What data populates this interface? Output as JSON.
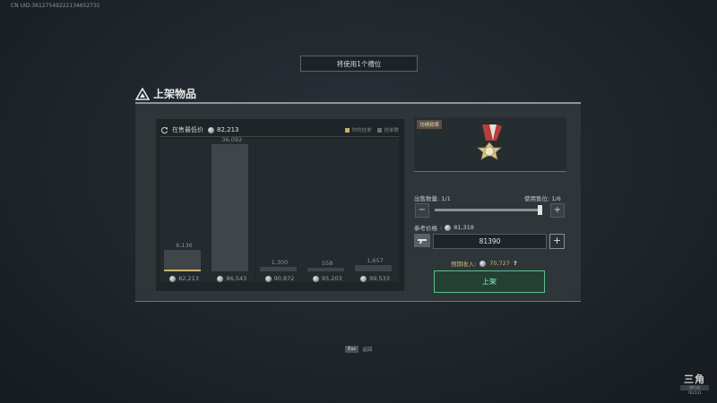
{
  "uid": "CN UID:36127549222134652731",
  "slot_notice": "将使用1个槽位",
  "title": "上架物品",
  "chart": {
    "lowest_label": "在售最低价",
    "lowest_price": "82,213",
    "legend_mine": "你的挂单",
    "legend_orders": "挂单数",
    "accent_color": "#c8b46a"
  },
  "chart_data": {
    "type": "bar",
    "categories": [
      "82,213",
      "86,543",
      "90,872",
      "95,203",
      "99,533"
    ],
    "series": [
      {
        "values": [
          6136,
          36092,
          1300,
          558,
          1657
        ]
      }
    ],
    "value_labels": [
      "6,136",
      "36,092",
      "1,300",
      "558",
      "1,657"
    ],
    "ylim": [
      0,
      37500
    ]
  },
  "item": {
    "name_tag": "功绩勋章",
    "icon": "medal-icon"
  },
  "quantity": {
    "label": "出售数量",
    "value": "1/1",
    "slot_label": "使用售位",
    "slot_value": "1/6",
    "minus": "−",
    "plus": "+",
    "slider_fraction": 1.0
  },
  "reference": {
    "label": "参考价格",
    "value": "81,318"
  },
  "price_input": {
    "value": "81390",
    "plus": "+"
  },
  "expected": {
    "label": "预期收入",
    "value": "70,727",
    "help": "?"
  },
  "list_button": "上架",
  "footer": {
    "esc_key": "Esc",
    "esc_label": "返回"
  },
  "logo": {
    "big": "三角",
    "small": "洲行动",
    "num": "762131"
  }
}
